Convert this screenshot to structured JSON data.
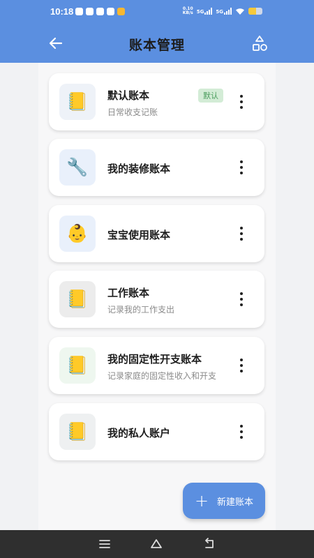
{
  "status_bar": {
    "time": "10:18",
    "speed_value": "0.10",
    "speed_unit": "KB/s",
    "sig1": "5G",
    "sig2": "5G",
    "battery_level": 0.55
  },
  "app_bar": {
    "title": "账本管理",
    "back_icon": "arrow-left-icon",
    "category_icon": "shapes-icon"
  },
  "books": [
    {
      "name": "默认账本",
      "desc": "日常收支记账",
      "icon": "📒",
      "icon_bg": "#eef2f8",
      "badge": "默认"
    },
    {
      "name": "我的装修账本",
      "desc": "",
      "icon": "🔧",
      "icon_bg": "#e9f0fb"
    },
    {
      "name": "宝宝使用账本",
      "desc": "",
      "icon": "👶",
      "icon_bg": "#e9f0fb"
    },
    {
      "name": "工作账本",
      "desc": "记录我的工作支出",
      "icon": "📒",
      "icon_bg": "#ececec"
    },
    {
      "name": "我的固定性开支账本",
      "desc": "记录家庭的固定性收入和开支",
      "icon": "📒",
      "icon_bg": "#eef7ef"
    },
    {
      "name": "我的私人账户",
      "desc": "",
      "icon": "📒",
      "icon_bg": "#eef0f1"
    }
  ],
  "fab": {
    "label": "新建账本",
    "icon": "plus-icon"
  },
  "nav": {
    "menu_icon": "menu-icon",
    "home_icon": "home-icon",
    "back_icon": "back-icon"
  },
  "colors": {
    "primary": "#5b8fe0",
    "badge_bg": "#d3ecd6",
    "badge_text": "#4a9c5c"
  }
}
